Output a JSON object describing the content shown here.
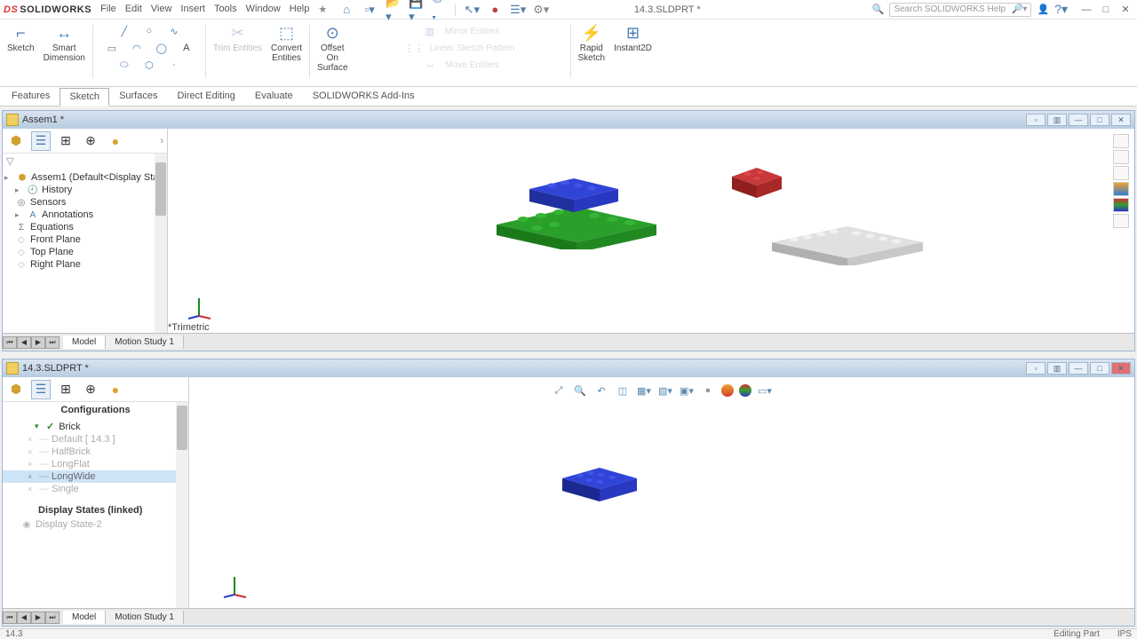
{
  "app": {
    "logo_text": "SOLIDWORKS",
    "current_doc": "14.3.SLDPRT *",
    "search_placeholder": "Search SOLIDWORKS Help"
  },
  "menu": [
    "File",
    "Edit",
    "View",
    "Insert",
    "Tools",
    "Window",
    "Help"
  ],
  "ribbon": {
    "sketch": "Sketch",
    "smart_dim": "Smart\nDimension",
    "trim": "Trim Entities",
    "convert": "Convert\nEntities",
    "offset": "Offset\nOn\nSurface",
    "rapid": "Rapid\nSketch",
    "instant2d": "Instant2D"
  },
  "cmd_tabs": [
    "Features",
    "Sketch",
    "Surfaces",
    "Direct Editing",
    "Evaluate",
    "SOLIDWORKS Add-Ins"
  ],
  "cmd_active": 1,
  "doc_top": {
    "title": "Assem1 *",
    "tree_root": "Assem1  (Default<Display Stat",
    "tree_items": [
      {
        "icon": "H",
        "label": "History"
      },
      {
        "icon": "S",
        "label": "Sensors"
      },
      {
        "icon": "A",
        "label": "Annotations"
      },
      {
        "icon": "Σ",
        "label": "Equations"
      },
      {
        "icon": "◇",
        "label": "Front Plane"
      },
      {
        "icon": "◇",
        "label": "Top Plane"
      },
      {
        "icon": "◇",
        "label": "Right Plane"
      }
    ],
    "view_label": "*Trimetric",
    "tabs": [
      "Model",
      "Motion Study 1"
    ],
    "tab_active": 0
  },
  "doc_bottom": {
    "title": "14.3.SLDPRT *",
    "configs_header": "Configurations",
    "config_root": "Brick",
    "configs": [
      {
        "label": "Default [ 14.3 ]",
        "sel": false,
        "dim": true
      },
      {
        "label": "HalfBrick",
        "sel": false,
        "dim": true
      },
      {
        "label": "LongFlat",
        "sel": false,
        "dim": true
      },
      {
        "label": "LongWide",
        "sel": true,
        "dim": false
      },
      {
        "label": "Single",
        "sel": false,
        "dim": true
      }
    ],
    "display_states_header": "Display States (linked)",
    "display_state": "Display State-2",
    "tabs": [
      "Model",
      "Motion Study 1"
    ],
    "tab_active": 0
  },
  "status": {
    "left": "14.3",
    "editing": "Editing Part",
    "units": "IPS"
  },
  "colors": {
    "green": "#2aa02a",
    "blue": "#2838c8",
    "red": "#b02828",
    "gray": "#d0d0d0"
  }
}
